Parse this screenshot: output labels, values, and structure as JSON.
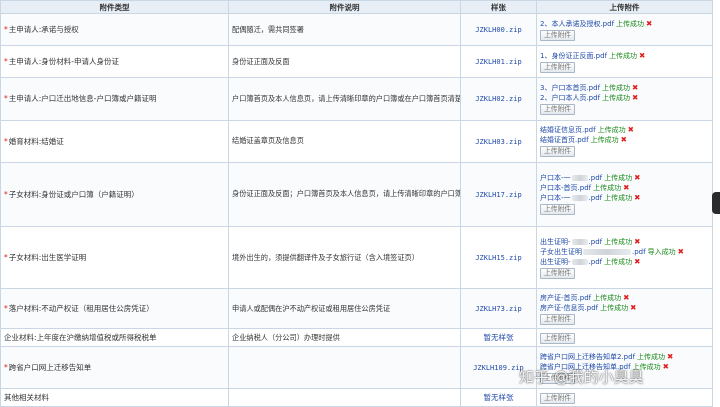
{
  "table": {
    "headers": [
      "附件类型",
      "附件说明",
      "样张",
      "上传附件"
    ],
    "required_mark": "*",
    "upload_button_label": "上传附件",
    "rows": [
      {
        "type": "主申请人:承诺与授权",
        "required": true,
        "desc": "配偶随迁，需共同签署",
        "sample": "JZKLH00.zip",
        "files": [
          {
            "name": "2、本人承诺及授权.pdf",
            "status": "上传成功"
          }
        ]
      },
      {
        "type": "主申请人:身份材料-申请人身份证",
        "required": true,
        "desc": "身份证正面及反面",
        "sample": "JZKLH01.zip",
        "files": [
          {
            "name": "1、身份证正反面.pdf",
            "status": "上传成功"
          }
        ]
      },
      {
        "type": "主申请人:户口迁出地信息-户口簿或户籍证明",
        "required": true,
        "desc": "户口簿首页及本人信息页，请上传清晰印章的户口簿或在户口簿首页清楚标注印章内容",
        "sample": "JZKLH02.zip",
        "files": [
          {
            "name": "3、户口本首页.pdf",
            "status": "上传成功"
          },
          {
            "name": "2、户口本人页.pdf",
            "status": "上传成功"
          }
        ]
      },
      {
        "type": "婚育材料:结婚证",
        "required": true,
        "desc": "结婚证盖章页及信息页",
        "sample": "JZKLH03.zip",
        "files": [
          {
            "name": "结婚证信息页.pdf",
            "status": "上传成功"
          },
          {
            "name": "结婚证首页.pdf",
            "status": "上传成功"
          }
        ]
      },
      {
        "type": "子女材料:身份证或户口簿（户籍证明）",
        "required": true,
        "desc": "身份证正面及反面；户口簿首页及本人信息页，请上传清晰印章的户口簿或在户口簿首页清楚标注印章内容",
        "sample": "JZKLH17.zip",
        "files": [
          {
            "name": "户口本-一",
            "blurred": true,
            "tail": ".pdf",
            "status": "上传成功"
          },
          {
            "name": "户口本-首页.pdf",
            "status": "上传成功"
          },
          {
            "name": "户口本-一",
            "blurred": true,
            "tail": ".pdf",
            "status": "上传成功"
          }
        ]
      },
      {
        "type": "子女材料:出生医学证明",
        "required": true,
        "desc": "境外出生的，须提供翻译件及子女旅行证（含入境签证页）",
        "sample": "JZKLH15.zip",
        "files": [
          {
            "name": "出生证明-",
            "blurred": true,
            "tail": ".pdf",
            "status": "上传成功"
          },
          {
            "name": "子女出生证明",
            "blurred": true,
            "long": true,
            "tail": ".pdf",
            "status": "导入成功"
          },
          {
            "name": "出生证明-",
            "blurred": true,
            "tail": ".pdf",
            "status": "上传成功"
          }
        ]
      },
      {
        "type": "落户材料:不动产权证（租用居住公房凭证）",
        "required": true,
        "desc": "申请人或配偶在沪不动产权证或租用居住公房凭证",
        "sample": "JZKLH73.zip",
        "files": [
          {
            "name": "房产证-首页.pdf",
            "status": "上传成功"
          },
          {
            "name": "房产证-信息页.pdf",
            "status": "上传成功"
          }
        ]
      },
      {
        "type": "企业材料:上年度在沪缴纳增值税或所得税税单",
        "required": false,
        "desc": "企业纳税人（分公司）办理时提供",
        "sample_none": "暂无样张",
        "files": []
      },
      {
        "type": "跨省户口网上迁移告知单",
        "required": true,
        "desc": "",
        "sample": "JZKLH109.zip",
        "files": [
          {
            "name": "跨省户口网上迁移告知单2.pdf",
            "status": "上传成功"
          },
          {
            "name": "跨省户口网上迁移告知单.pdf",
            "status": "上传成功"
          }
        ]
      },
      {
        "type": "其他相关材料",
        "required": false,
        "desc": "",
        "sample_none": "暂无样张",
        "files": []
      }
    ]
  },
  "watermark": "知乎 @我的小臭臭",
  "colors": {
    "header_bg": "#e7eef6",
    "border": "#c9d6e3",
    "link": "#1f4aa8",
    "success": "#1a8a1a",
    "delete": "#e02020"
  },
  "icons": {
    "delete": "red-x-icon"
  }
}
